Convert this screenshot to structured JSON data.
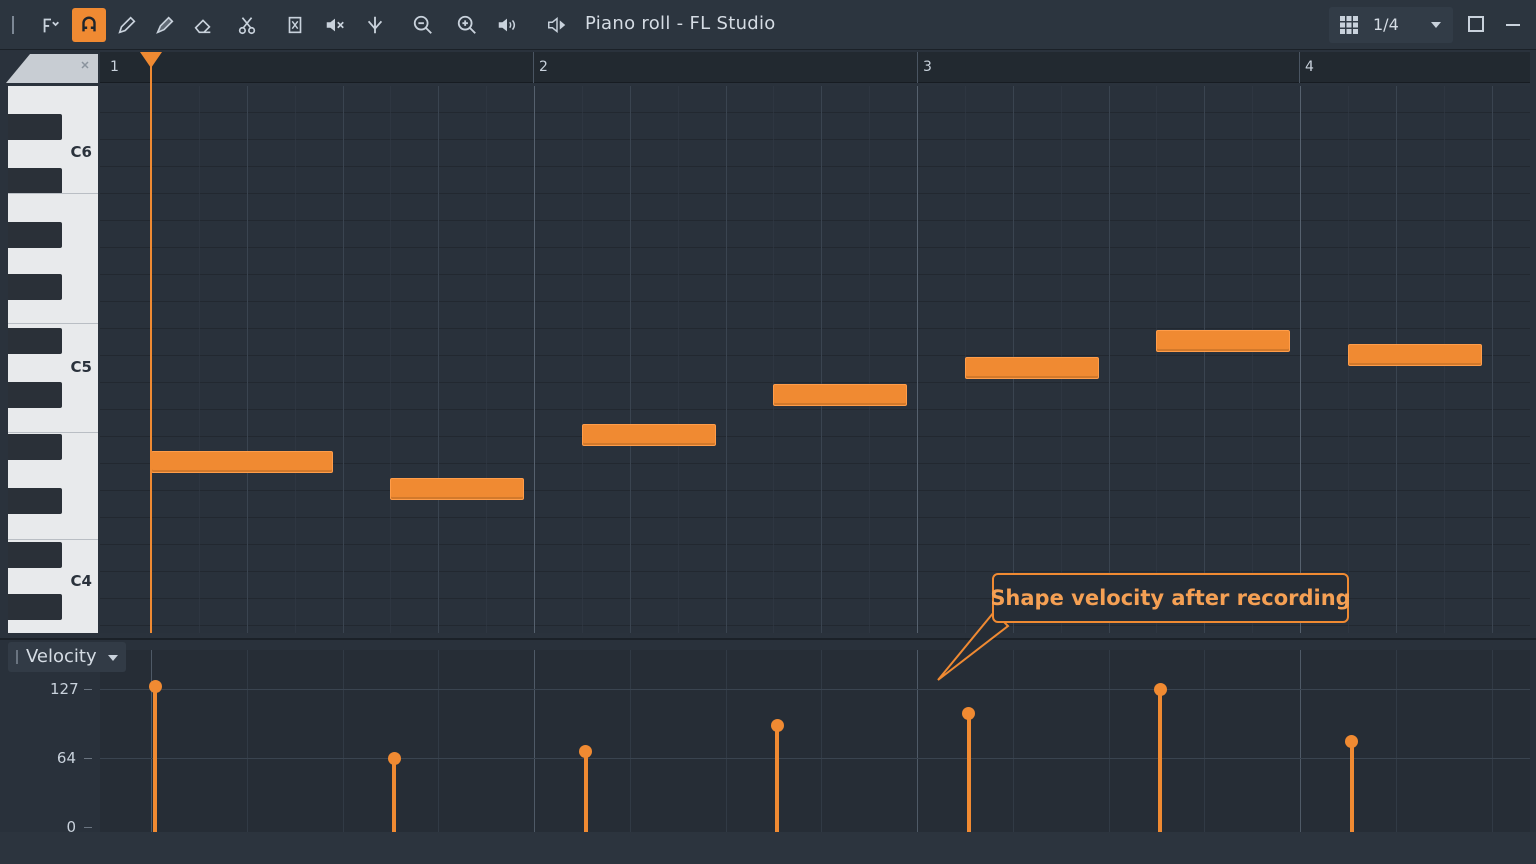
{
  "window": {
    "title": "Piano roll - FL Studio",
    "snap_value": "1/4"
  },
  "toolbar": {
    "buttons": [
      {
        "name": "menu-arrow",
        "icon": "piano-roll-menu-icon"
      },
      {
        "name": "magnet",
        "icon": "magnet-icon",
        "active": true
      },
      {
        "name": "draw",
        "icon": "pencil-icon"
      },
      {
        "name": "paint",
        "icon": "brush-icon"
      },
      {
        "name": "erase",
        "icon": "eraser-icon"
      },
      {
        "name": "slice",
        "icon": "scissors-icon"
      },
      {
        "name": "select",
        "icon": "select-icon"
      },
      {
        "name": "mute",
        "icon": "mute-icon"
      },
      {
        "name": "slip",
        "icon": "slip-icon"
      },
      {
        "name": "zoom",
        "icon": "zoom-icon"
      },
      {
        "name": "zoom-in",
        "icon": "zoom-in-icon"
      },
      {
        "name": "playback",
        "icon": "speaker-icon"
      }
    ]
  },
  "ruler": {
    "bars": [
      "1",
      "2",
      "3",
      "4"
    ]
  },
  "keyboard": {
    "labels": [
      "C6",
      "C5",
      "C4"
    ]
  },
  "velocity": {
    "panel_label": "Velocity",
    "ticks": [
      "127",
      "64",
      "0"
    ]
  },
  "callout": {
    "text": "Shape velocity after recording"
  },
  "colors": {
    "accent": "#f08a32",
    "background": "#29313b"
  },
  "notes": [
    {
      "start": 0.0,
      "length": 0.5,
      "pitch": "F4",
      "velocity": 127
    },
    {
      "start": 0.625,
      "length": 0.375,
      "pitch": "D#4",
      "velocity": 64
    },
    {
      "start": 1.125,
      "length": 0.375,
      "pitch": "G4",
      "velocity": 70
    },
    {
      "start": 1.625,
      "length": 0.375,
      "pitch": "A#4",
      "velocity": 93
    },
    {
      "start": 2.125,
      "length": 0.375,
      "pitch": "C5",
      "velocity": 103
    },
    {
      "start": 2.625,
      "length": 0.375,
      "pitch": "D5",
      "velocity": 124
    },
    {
      "start": 3.125,
      "length": 0.375,
      "pitch": "C#5",
      "velocity": 79
    }
  ]
}
